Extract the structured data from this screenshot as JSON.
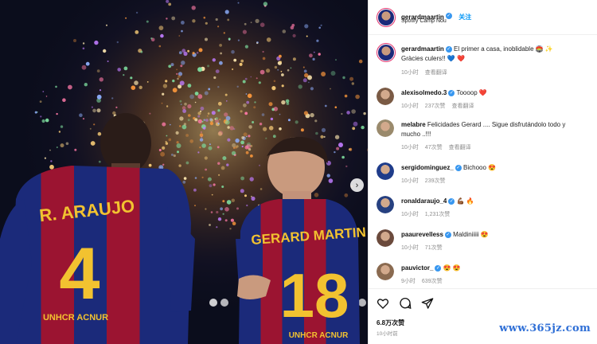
{
  "post": {
    "username": "gerardmaartin",
    "follow_label": "关注",
    "location": "Spotify Camp Nou",
    "caption_line1": "El primer a casa, inoblidable 🏟️ ✨",
    "caption_line2": "Gràcies culers!! 💙 ❤️",
    "caption_time": "10小时",
    "caption_translate": "查看翻译",
    "likes": "6.8万次赞",
    "posted": "10小时前"
  },
  "comments": [
    {
      "user": "alexisolmedo.3",
      "text": "Toooop",
      "emoji": "❤️",
      "time": "10小时",
      "likes": "237次赞",
      "translate": "查看翻译",
      "avatar_color": "#7a5a44"
    },
    {
      "user": "melabre",
      "text": "Felicidades Gerard .... Sigue disfrutándolo todo y",
      "text2": "mucho ..!!!",
      "time": "10小时",
      "likes": "47次赞",
      "translate": "查看翻译",
      "avatar_color": "#9a8a6c"
    },
    {
      "user": "sergidominguez_",
      "text": "Bichooo",
      "emoji": "😍",
      "time": "10小时",
      "likes": "239次赞",
      "avatar_color": "#1f3c8a"
    },
    {
      "user": "ronaldaraujo_4",
      "text": "",
      "emoji": "💪🏾 🔥",
      "time": "10小时",
      "likes": "1,231次赞",
      "avatar_color": "#264080"
    },
    {
      "user": "paaurevelless",
      "text": "Maldiniiiii",
      "emoji": "😍",
      "time": "10小时",
      "likes": "71次赞",
      "avatar_color": "#6b4a3c"
    },
    {
      "user": "pauvictor_",
      "text": "",
      "emoji": "😍 😍",
      "time": "9小时",
      "likes": "639次赞",
      "avatar_color": "#8a6a50"
    }
  ],
  "photo": {
    "player1_name": "R. ARAUJO",
    "player1_number": "4",
    "player2_name": "GERARD MARTIN",
    "player2_number": "18",
    "sponsor": "UNHCR ACNUR"
  },
  "watermark": "www.365jz.com",
  "colors": {
    "accent": "#0095f6",
    "verified": "#3897f0",
    "heart": "#e0245e",
    "watermark": "#2f6fd6"
  }
}
